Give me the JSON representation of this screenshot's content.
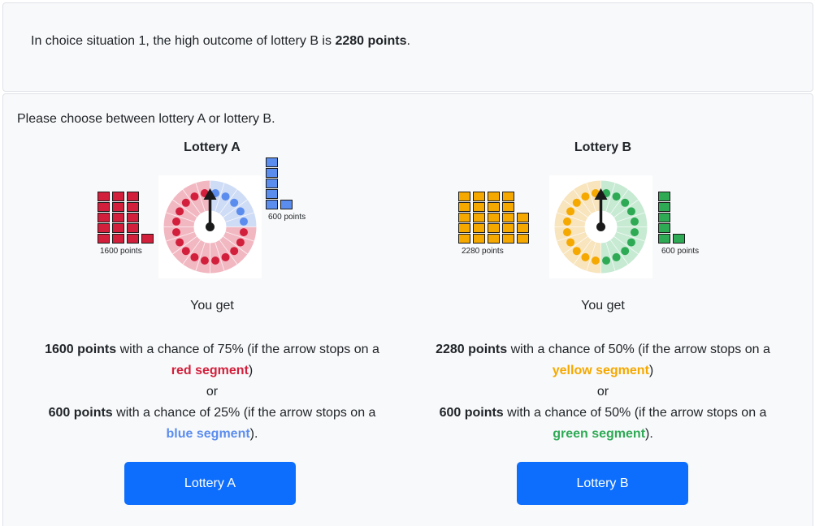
{
  "header": {
    "prefix": "In choice situation 1, the high outcome of lottery B is",
    "highlight": "2280 points",
    "suffix": "."
  },
  "prompt": "Please choose between lottery A or lottery B.",
  "you_get": "You get",
  "or_word": "or",
  "lotteries": [
    {
      "title": "Lottery A",
      "high_points": "1600 points",
      "high_text": "with a chance of 75% (if the arrow stops on a",
      "high_segment": "red segment",
      "high_close": ")",
      "low_points": "600 points",
      "low_text": "with a chance of 25% (if the arrow stops on a",
      "low_segment": "blue segment",
      "low_close": ").",
      "stack_high_label": "1600 points",
      "stack_low_label": "600 points",
      "high_color": "#d21f3c",
      "low_color": "#5b8def",
      "high_fill": "#f2b8c2",
      "low_fill": "#cfdcf6",
      "high_probability": 0.75,
      "button": "Lottery A"
    },
    {
      "title": "Lottery B",
      "high_points": "2280 points",
      "high_text": "with a chance of 50% (if the arrow stops on a",
      "high_segment": "yellow segment",
      "high_close": ")",
      "low_points": "600 points",
      "low_text": "with a chance of 50% (if the arrow stops on a",
      "low_segment": "green segment",
      "low_close": ").",
      "stack_high_label": "2280 points",
      "stack_low_label": "600 points",
      "high_color": "#f5a800",
      "low_color": "#2eaa55",
      "high_fill": "#f8e4bd",
      "low_fill": "#c7ead3",
      "high_probability": 0.5,
      "button": "Lottery B"
    }
  ]
}
